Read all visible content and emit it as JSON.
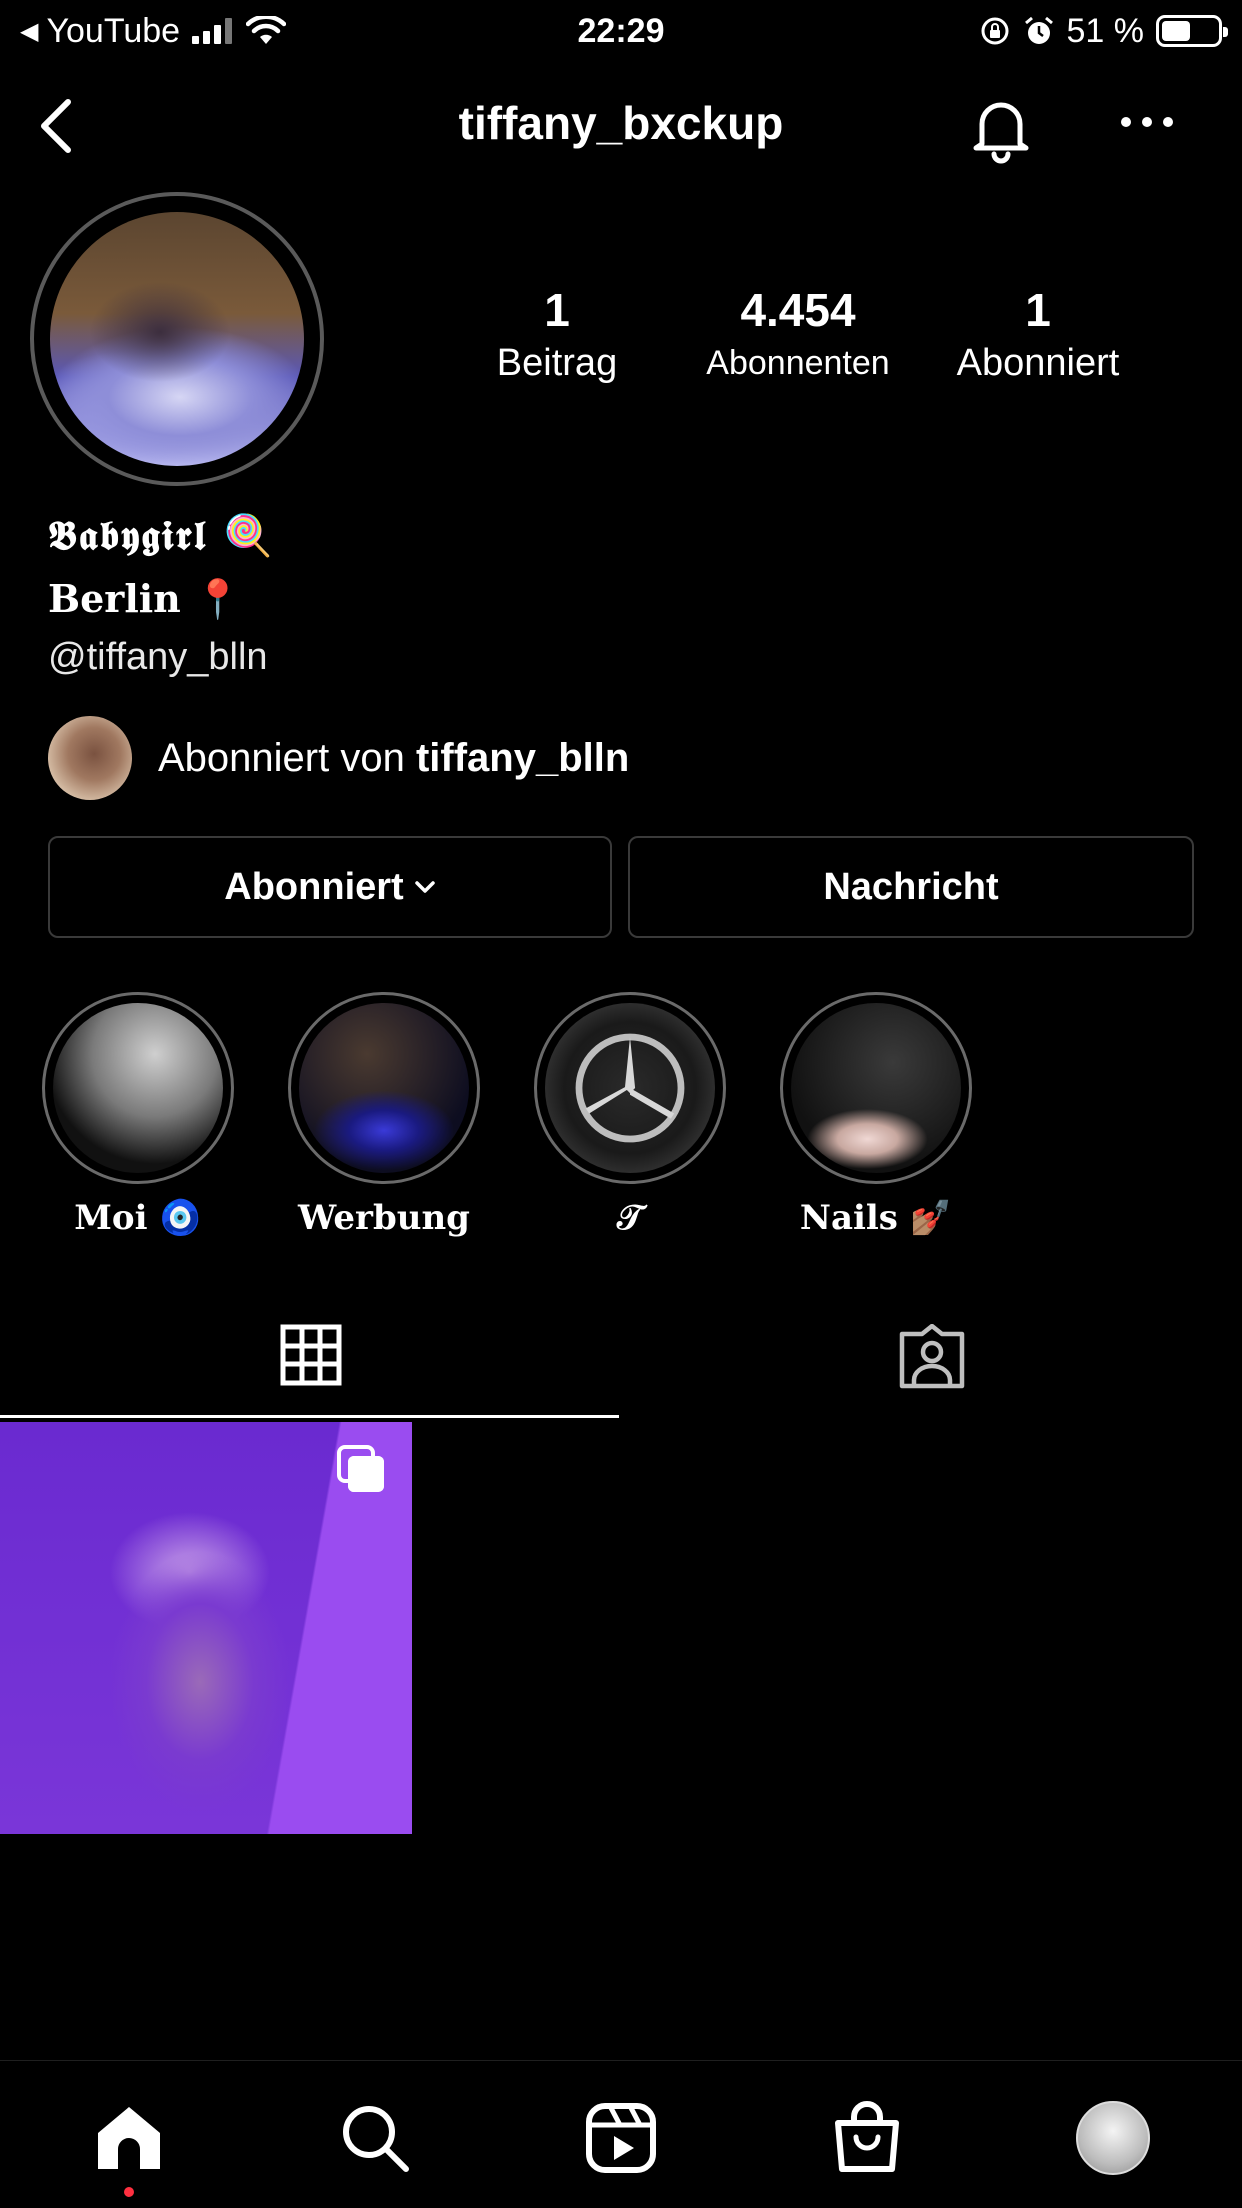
{
  "status_bar": {
    "back_app": "YouTube",
    "time": "22:29",
    "battery": "51 %",
    "battery_level": 0.51
  },
  "header": {
    "username": "tiffany_bxckup"
  },
  "stats": [
    {
      "value": "1",
      "label": "Beitrag"
    },
    {
      "value": "4.454",
      "label": "Abonnenten"
    },
    {
      "value": "1",
      "label": "Abonniert"
    }
  ],
  "bio": {
    "name": "𝕭𝖆𝖇𝖞𝖌𝖎𝖗𝖑 🍭",
    "location": "Berlin 📍",
    "link": "@tiffany_blln"
  },
  "followed_by": {
    "prefix": "Abonniert von ",
    "username": "tiffany_blln"
  },
  "buttons": {
    "following": "Abonniert",
    "message": "Nachricht"
  },
  "highlights": [
    {
      "label": "Moi 🧿"
    },
    {
      "label": "Werbung"
    },
    {
      "label": "𝒯"
    },
    {
      "label": "Nails 💅🏽"
    }
  ],
  "colors": {
    "background": "#000000",
    "text": "#ffffff",
    "border": "#3a3a3a",
    "notification_dot": "#ff3040"
  }
}
